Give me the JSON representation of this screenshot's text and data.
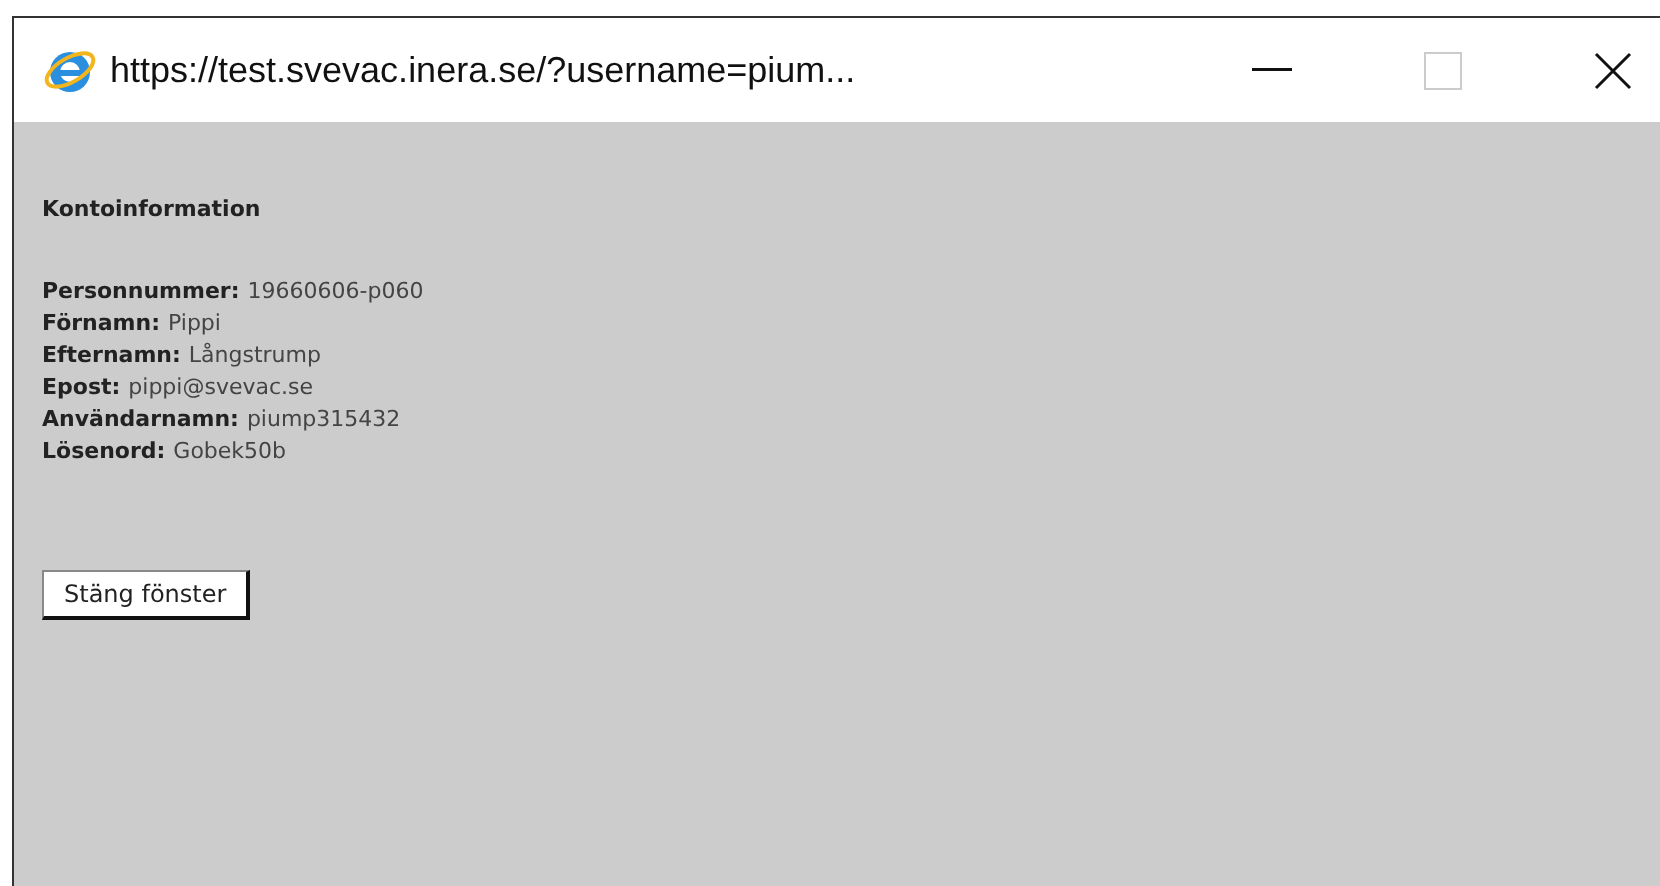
{
  "window": {
    "title": "https://test.svevac.inera.se/?username=pium..."
  },
  "heading": "Kontoinformation",
  "fields": [
    {
      "label": "Personnummer:",
      "value": "19660606-p060"
    },
    {
      "label": "Förnamn:",
      "value": "Pippi"
    },
    {
      "label": "Efternamn:",
      "value": "Långstrump"
    },
    {
      "label": "Epost:",
      "value": "pippi@svevac.se"
    },
    {
      "label": "Användarnamn:",
      "value": "piump315432"
    },
    {
      "label": "Lösenord:",
      "value": "Gobek50b"
    }
  ],
  "buttons": [
    "Stäng fönster"
  ]
}
